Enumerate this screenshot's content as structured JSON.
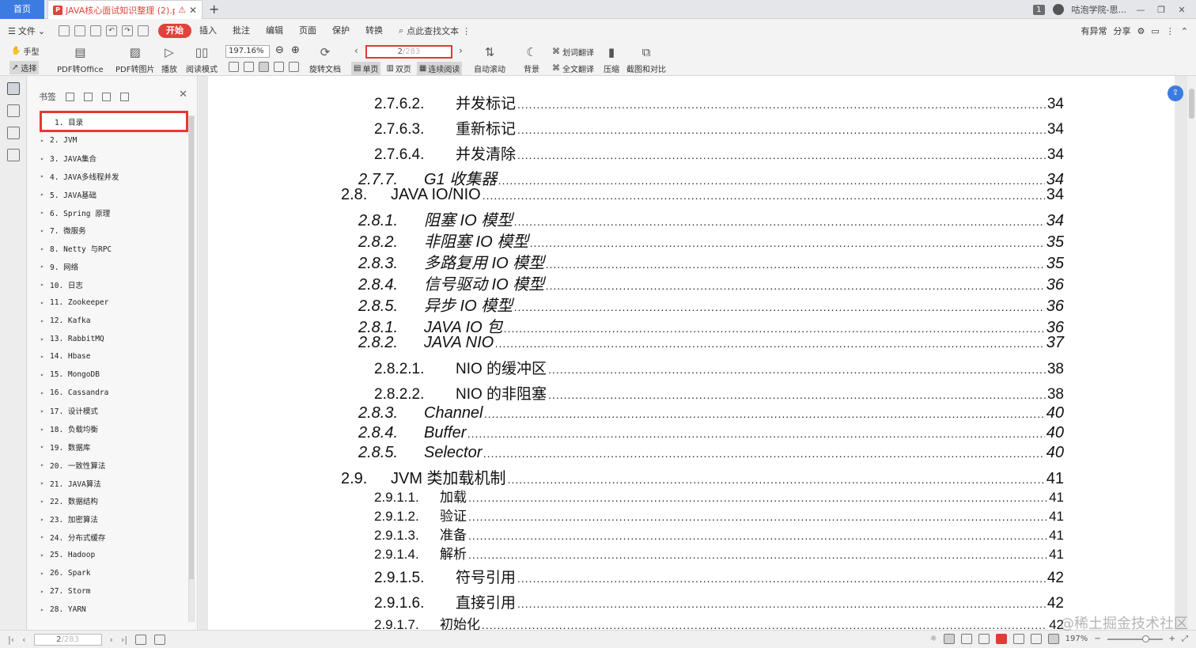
{
  "tabbar": {
    "home_label": "首页",
    "doc_title": "JAVA核心面试知识整理 (2).pdf",
    "pdf_badge": "P",
    "warn_glyph": "⚠",
    "close_glyph": "✕",
    "add_glyph": "+",
    "badge_count": "1",
    "user_name": "咕泡学院-思...",
    "min_glyph": "—",
    "restore_glyph": "❐",
    "close_win_glyph": "✕"
  },
  "menu": {
    "file_label": "文件",
    "tabs": [
      "开始",
      "插入",
      "批注",
      "编辑",
      "页面",
      "保护",
      "转换"
    ],
    "active_tab": "开始",
    "search_label": "点此查找文本",
    "right": [
      "有异常",
      "分享"
    ]
  },
  "ribbon": {
    "hand_label": "手型",
    "select_label": "选择",
    "pdf_office": "PDF转Office",
    "pdf_image": "PDF转图片",
    "play": "播放",
    "read_mode": "阅读模式",
    "zoom": "197.16%",
    "rotate": "旋转文档",
    "page_current": "2",
    "page_total": "/283",
    "single": "单页",
    "double": "双页",
    "continuous": "连续阅读",
    "auto_scroll": "自动滚动",
    "background": "背景",
    "word_translate": "划词翻译",
    "full_translate": "全文翻译",
    "compress": "压缩",
    "screenshot": "截图和对比"
  },
  "bookmarks": {
    "title": "书签",
    "items": [
      "1. 目录",
      "2. JVM",
      "3. JAVA集合",
      "4. JAVA多线程并发",
      "5. JAVA基础",
      "6. Spring 原理",
      "7.  微服务",
      "8. Netty 与RPC",
      "9. 网络",
      "10. 日志",
      "11. Zookeeper",
      "12. Kafka",
      "13. RabbitMQ",
      "14. Hbase",
      "15. MongoDB",
      "16. Cassandra",
      "17. 设计模式",
      "18. 负载均衡",
      "19. 数据库",
      "20. 一致性算法",
      "21. JAVA算法",
      "22. 数据结构",
      "23. 加密算法",
      "24. 分布式缓存",
      "25. Hadoop",
      "26. Spark",
      "27. Storm",
      "28. YARN"
    ]
  },
  "toc": [
    {
      "num": "2.7.6.2.",
      "title": "并发标记",
      "page": "34",
      "style": "lvl4"
    },
    {
      "num": "2.7.6.3.",
      "title": "重新标记",
      "page": "34",
      "style": "lvl4"
    },
    {
      "num": "2.7.6.4.",
      "title": "并发清除",
      "page": "34",
      "style": "lvl4"
    },
    {
      "num": "2.7.7.",
      "title": "G1 收集器",
      "page": "34",
      "style": "lvl3"
    },
    {
      "num": "2.8.",
      "title": "JAVA IO/NIO",
      "page": "34",
      "style": "lvl2"
    },
    {
      "num": "2.8.1.",
      "title": "阻塞 IO 模型",
      "page": "34",
      "style": "lvl3"
    },
    {
      "num": "2.8.2.",
      "title": "非阻塞 IO 模型",
      "page": "35",
      "style": "lvl3"
    },
    {
      "num": "2.8.3.",
      "title": "多路复用 IO 模型",
      "page": "35",
      "style": "lvl3"
    },
    {
      "num": "2.8.4.",
      "title": "信号驱动 IO 模型",
      "page": "36",
      "style": "lvl3"
    },
    {
      "num": "2.8.5.",
      "title": "异步 IO 模型",
      "page": "36",
      "style": "lvl3"
    },
    {
      "num": "2.8.1.",
      "title": "JAVA IO 包",
      "page": "36",
      "style": "lvl3"
    },
    {
      "num": "2.8.2.",
      "title": "JAVA NIO",
      "page": "37",
      "style": "lvl3"
    },
    {
      "num": "2.8.2.1.",
      "title": "NIO 的缓冲区",
      "page": "38",
      "style": "lvl4"
    },
    {
      "num": "2.8.2.2.",
      "title": "NIO 的非阻塞",
      "page": "38",
      "style": "lvl4"
    },
    {
      "num": "2.8.3.",
      "title": "Channel",
      "page": "40",
      "style": "lvl3"
    },
    {
      "num": "2.8.4.",
      "title": "Buffer",
      "page": "40",
      "style": "lvl3"
    },
    {
      "num": "2.8.5.",
      "title": "Selector",
      "page": "40",
      "style": "lvl3"
    },
    {
      "num": "2.9.",
      "title": "JVM 类加载机制",
      "page": "41",
      "style": "lvl2"
    },
    {
      "num": "2.9.1.1.",
      "title": "加载",
      "page": "41",
      "style": "lvl4s"
    },
    {
      "num": "2.9.1.2.",
      "title": "验证",
      "page": "41",
      "style": "lvl4s"
    },
    {
      "num": "2.9.1.3.",
      "title": "准备",
      "page": "41",
      "style": "lvl4s"
    },
    {
      "num": "2.9.1.4.",
      "title": "解析",
      "page": "41",
      "style": "lvl4s"
    },
    {
      "num": "2.9.1.5.",
      "title": "符号引用",
      "page": "42",
      "style": "lvl4"
    },
    {
      "num": "2.9.1.6.",
      "title": "直接引用",
      "page": "42",
      "style": "lvl4"
    },
    {
      "num": "2.9.1.7.",
      "title": "初始化",
      "page": "42",
      "style": "lvl4s"
    }
  ],
  "status": {
    "page_current": "2",
    "page_total": "/283",
    "zoom": "197%"
  },
  "watermark": "@稀土掘金技术社区",
  "colors": {
    "accent_red": "#e0433b",
    "highlight_red": "#e53935",
    "brand_blue": "#3c7ce0"
  }
}
